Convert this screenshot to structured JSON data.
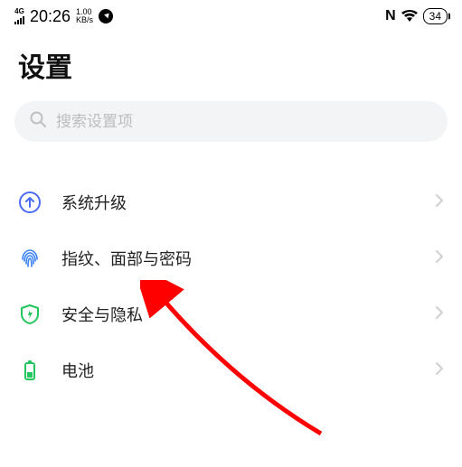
{
  "status": {
    "network_type": "4G",
    "time": "20:26",
    "speed_value": "1.00",
    "speed_unit": "KB/s",
    "nfc": "N",
    "battery_pct": "34"
  },
  "page_title": "设置",
  "search": {
    "placeholder": "搜索设置项"
  },
  "items": [
    {
      "label": "系统升级"
    },
    {
      "label": "指纹、面部与密码"
    },
    {
      "label": "安全与隐私"
    },
    {
      "label": "电池"
    }
  ]
}
